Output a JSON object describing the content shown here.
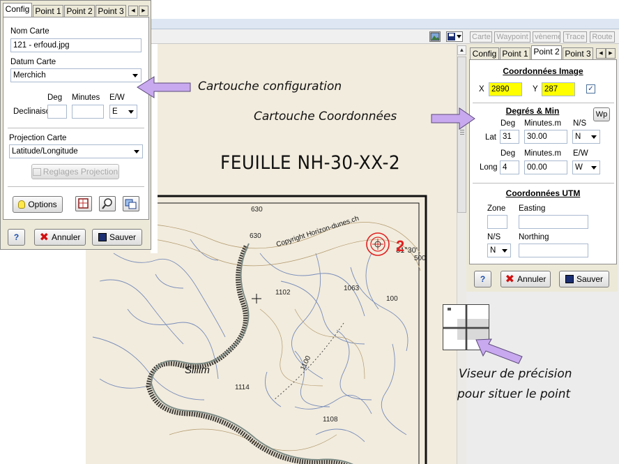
{
  "toolbar": {
    "modes": [
      "Carte",
      "Waypoint",
      "vèneme",
      "Trace",
      "Route"
    ]
  },
  "map": {
    "sheet_title": "FEUILLE  NH-30-XX-2",
    "copyright": "Copyright Horizon-dunes.ch",
    "place_name": "Slilim",
    "coord_label": "31°30'",
    "point_label": "2",
    "numbers": [
      "630",
      "630",
      "500",
      "1102",
      "1063",
      "100",
      "1100",
      "1114",
      "1108"
    ]
  },
  "config_panel": {
    "tabs": [
      "Config",
      "Point 1",
      "Point 2",
      "Point 3"
    ],
    "nom_carte_label": "Nom Carte",
    "nom_carte_value": "121 - erfoud.jpg",
    "datum_label": "Datum Carte",
    "datum_value": "Merchich",
    "deg_label": "Deg",
    "minutes_label": "Minutes",
    "ew_label": "E/W",
    "declinaison_label": "Declinaisc",
    "ew_value": "E",
    "projection_label": "Projection Carte",
    "projection_value": "Latitude/Longitude",
    "reglages_label": "Reglages Projection",
    "options_label": "Options",
    "help_label": "?",
    "annuler_label": "Annuler",
    "sauver_label": "Sauver"
  },
  "point_panel": {
    "tabs": [
      "Config",
      "Point 1",
      "Point 2",
      "Point 3"
    ],
    "image_title": "Coordonnées Image",
    "x_label": "X",
    "x_value": "2890",
    "y_label": "Y",
    "y_value": "287",
    "degmin_title": "Degrés & Min",
    "wp_label": "Wp",
    "deg_label": "Deg",
    "minutes_label": "Minutes.m",
    "ns_label": "N/S",
    "ew_label": "E/W",
    "lat_label": "Lat",
    "lat_deg": "31",
    "lat_min": "30.00",
    "lat_ns": "N",
    "long_label": "Long",
    "long_deg": "4",
    "long_min": "00.00",
    "long_ew": "W",
    "utm_title": "Coordonnées UTM",
    "zone_label": "Zone",
    "easting_label": "Easting",
    "utm_ns_label": "N/S",
    "northing_label": "Northing",
    "utm_ns_value": "N",
    "help_label": "?",
    "annuler_label": "Annuler",
    "sauver_label": "Sauver"
  },
  "annotations": {
    "config": "Cartouche configuration",
    "coords": "Cartouche Coordonnées",
    "viseur_line1": "Viseur de précision",
    "viseur_line2": "pour situer le point"
  },
  "colors": {
    "arrow_fill": "#c8a8ee",
    "highlight_yellow": "#ffff00",
    "point_red": "#e02020"
  }
}
